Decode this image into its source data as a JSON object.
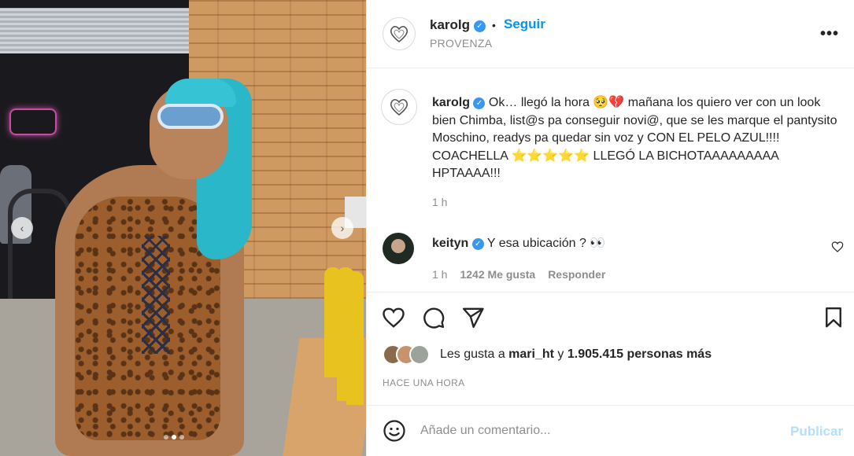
{
  "post": {
    "author": "karolg",
    "follow_label": "Seguir",
    "bullet": "•",
    "location": "PROVENZA",
    "more_label": "•••",
    "verified_glyph": "✓"
  },
  "caption": {
    "username": "karolg",
    "text": "Ok… llegó la hora 🥺💔 mañana los quiero ver con un look bien Chimba, list@s pa conseguir novi@, que se les marque el pantysito Moschino, readys pa quedar sin voz y CON EL PELO AZUL!!!! COACHELLA ⭐⭐⭐⭐⭐ LLEGÓ LA BICHOTAAAAAAAAA HPTAAAA!!!",
    "time": "1 h"
  },
  "comment": {
    "username": "keityn",
    "text": "Y esa ubicación ? 👀",
    "time": "1 h",
    "likes": "1242 Me gusta",
    "reply_label": "Responder"
  },
  "likes": {
    "prefix": "Les gusta a ",
    "user": "mari_ht",
    "middle": " y ",
    "count": "1.905.415 personas más"
  },
  "timestamp": "HACE UNA HORA",
  "comment_box": {
    "placeholder": "Añade un comentario...",
    "publish_label": "Publicar"
  },
  "carousel": {
    "prev_glyph": "‹",
    "next_glyph": "›"
  },
  "colors": {
    "accent": "#0095f6",
    "publish_disabled": "#b2dffc",
    "verified": "#3897f0"
  },
  "icons": [
    "heart-icon",
    "comment-icon",
    "share-icon",
    "bookmark-icon",
    "emoji-icon",
    "more-options-icon",
    "verified-badge-icon"
  ]
}
